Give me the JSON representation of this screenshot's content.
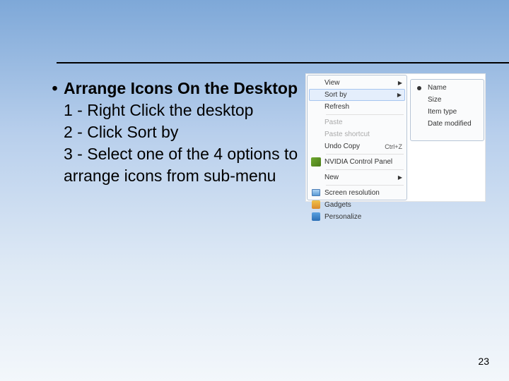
{
  "divider": true,
  "bullet": {
    "title": "Arrange Icons On the Desktop"
  },
  "steps": {
    "s1": "1 - Right Click the desktop",
    "s2": "2 - Click Sort by",
    "s3": "3 - Select one of the 4 options to arrange icons from sub-menu"
  },
  "menu": {
    "view": "View",
    "sortby": "Sort by",
    "refresh": "Refresh",
    "paste": "Paste",
    "paste_sc": "Paste shortcut",
    "undo": "Undo Copy",
    "undo_key": "Ctrl+Z",
    "nvidia": "NVIDIA Control Panel",
    "new": "New",
    "screenres": "Screen resolution",
    "gadgets": "Gadgets",
    "personalize": "Personalize"
  },
  "submenu": {
    "name": "Name",
    "size": "Size",
    "itemtype": "Item type",
    "datemod": "Date modified"
  },
  "page_number": "23"
}
